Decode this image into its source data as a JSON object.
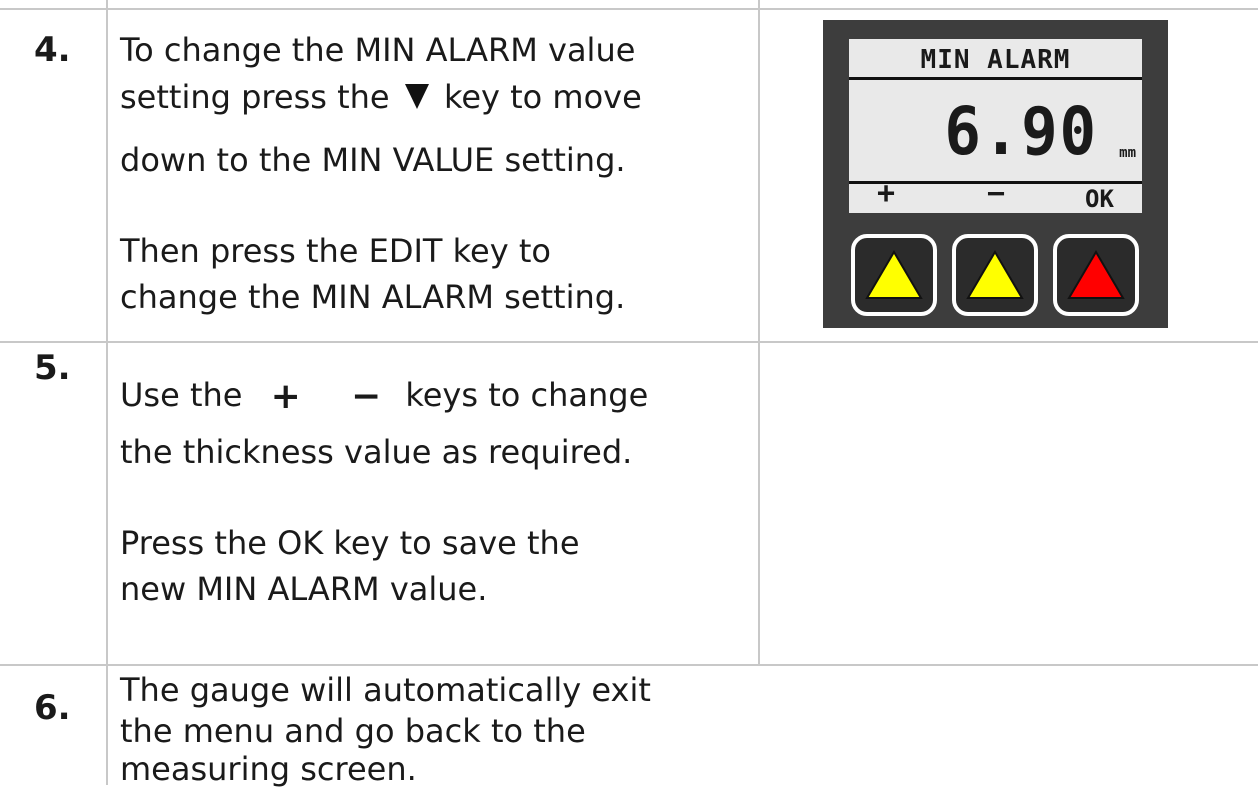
{
  "steps": [
    {
      "number": "4.",
      "lines_a": [
        "To change the MIN ALARM value",
        "setting press the",
        "key to move",
        "down to the MIN VALUE setting."
      ],
      "lines_b": [
        "Then press the EDIT key to",
        "change the MIN ALARM setting."
      ],
      "down_key_icon": "down-triangle-icon"
    },
    {
      "number": "5.",
      "line1_prefix": "Use the",
      "plus_key": "+",
      "minus_key": "−",
      "line1_suffix": "keys to change",
      "line2": "the thickness value as required.",
      "lines_b": [
        "Press the OK key to save the",
        "new MIN ALARM value."
      ]
    },
    {
      "number": "6.",
      "lines": [
        "The gauge will automatically exit",
        "the menu and go back to the",
        "measuring screen."
      ]
    }
  ],
  "device": {
    "screen_title": "MIN ALARM",
    "value": "6.90",
    "unit": "mm",
    "softkeys": {
      "plus": "+",
      "minus": "−",
      "ok": "OK"
    },
    "buttons": [
      {
        "name": "left-yellow-button",
        "color": "#ffff00"
      },
      {
        "name": "middle-yellow-button",
        "color": "#ffff00"
      },
      {
        "name": "right-red-button",
        "color": "#ff0000"
      }
    ],
    "body_color": "#3d3d3d",
    "screen_color": "#e9e9e9"
  }
}
